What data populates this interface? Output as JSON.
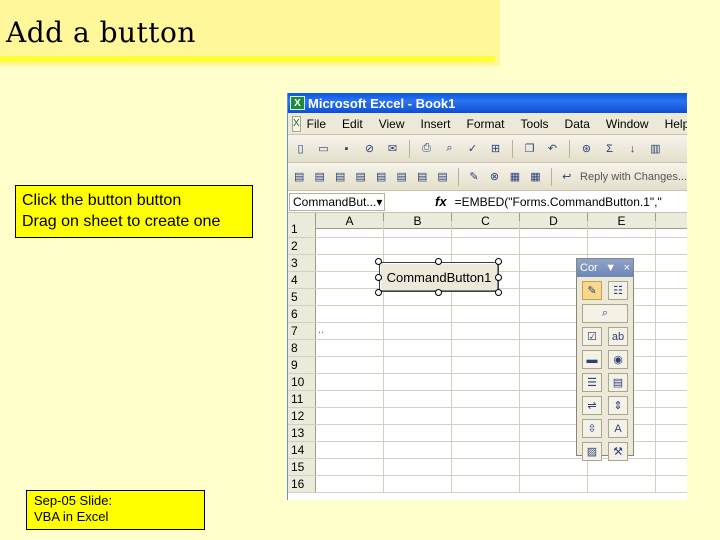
{
  "slide": {
    "title": "Add a button",
    "note_lines": [
      "Click the button button",
      "Drag on sheet to create one"
    ],
    "footer_lines": [
      "Sep-05 Slide:",
      "VBA in Excel"
    ]
  },
  "excel": {
    "window_title": "Microsoft Excel - Book1",
    "menu": [
      "File",
      "Edit",
      "View",
      "Insert",
      "Format",
      "Tools",
      "Data",
      "Window",
      "Help"
    ],
    "toolbar2_text": "Reply with Changes...",
    "name_box": "CommandBut...",
    "fx_label": "fx",
    "formula": "=EMBED(\"Forms.CommandButton.1\",\"",
    "columns": [
      "A",
      "B",
      "C",
      "D",
      "E"
    ],
    "rows": [
      "1",
      "2",
      "3",
      "4",
      "5",
      "6",
      "7",
      "8",
      "9",
      "10",
      "11",
      "12",
      "13",
      "14",
      "15",
      "16"
    ],
    "row7_text": "..",
    "command_button_label": "CommandButton1",
    "control_toolbox": {
      "title": "Cor",
      "close": "×",
      "dropdown": "▼",
      "icons": [
        {
          "name": "design-mode-icon",
          "glyph": "✎",
          "active": true
        },
        {
          "name": "properties-icon",
          "glyph": "☷"
        },
        {
          "name": "view-code-icon",
          "glyph": "⌕"
        },
        {
          "name": "checkbox-icon",
          "glyph": "☑"
        },
        {
          "name": "textbox-icon",
          "glyph": "ab"
        },
        {
          "name": "command-button-icon",
          "glyph": "▬"
        },
        {
          "name": "option-button-icon",
          "glyph": "◉"
        },
        {
          "name": "listbox-icon",
          "glyph": "☰"
        },
        {
          "name": "combobox-icon",
          "glyph": "▤"
        },
        {
          "name": "toggle-button-icon",
          "glyph": "⇌"
        },
        {
          "name": "scrollbar-icon",
          "glyph": "⇕"
        },
        {
          "name": "spin-button-icon",
          "glyph": "⇳"
        },
        {
          "name": "label-icon",
          "glyph": "A"
        },
        {
          "name": "image-icon",
          "glyph": "▨"
        },
        {
          "name": "more-controls-icon",
          "glyph": "⚒"
        }
      ]
    }
  }
}
